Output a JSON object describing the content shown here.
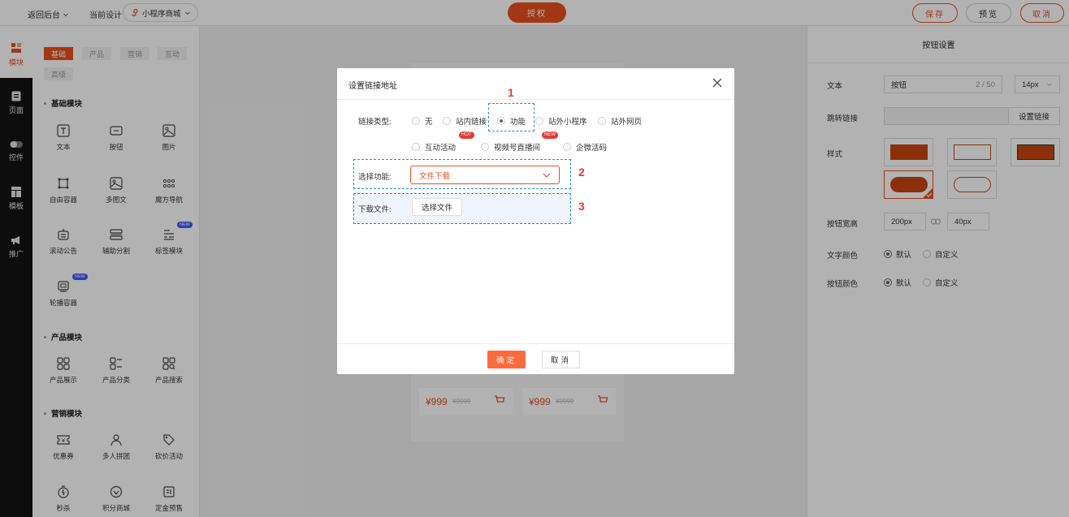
{
  "topbar": {
    "back_label": "返回后台",
    "current_design_label": "当前设计",
    "design_select_value": "小程序商城",
    "authorize_label": "授权",
    "save_label": "保存",
    "preview_label": "预览",
    "cancel_label": "取消",
    "accent_color": "#e8501c"
  },
  "rail": {
    "items": [
      {
        "label": "模块",
        "icon": "blocks-icon"
      },
      {
        "label": "页面",
        "icon": "page-icon"
      },
      {
        "label": "控件",
        "icon": "toggle-icon"
      },
      {
        "label": "模板",
        "icon": "template-icon"
      },
      {
        "label": "推广",
        "icon": "megaphone-icon"
      }
    ]
  },
  "panel": {
    "tabs": [
      "基础",
      "产品",
      "营销",
      "互动",
      "高级"
    ],
    "sections": [
      {
        "title": "基础模块",
        "items": [
          {
            "label": "文本"
          },
          {
            "label": "按钮"
          },
          {
            "label": "图片"
          },
          {
            "label": "自由容器"
          },
          {
            "label": "多图文"
          },
          {
            "label": "魔方导航"
          },
          {
            "label": "滚动公告"
          },
          {
            "label": "辅助分割"
          },
          {
            "label": "标签模块",
            "badge": "NEW"
          },
          {
            "label": "轮播容器",
            "badge": "NEW"
          }
        ]
      },
      {
        "title": "产品模块",
        "items": [
          {
            "label": "产品展示"
          },
          {
            "label": "产品分类"
          },
          {
            "label": "产品搜索"
          }
        ]
      },
      {
        "title": "营销模块",
        "items": [
          {
            "label": "优惠券"
          },
          {
            "label": "多人拼团"
          },
          {
            "label": "砍价活动"
          },
          {
            "label": "秒杀"
          },
          {
            "label": "积分商城"
          },
          {
            "label": "定金预售"
          }
        ]
      }
    ]
  },
  "canvas": {
    "product_price": "¥999",
    "product_orig_price": "¥9999"
  },
  "right_panel": {
    "title": "按钮设置",
    "text_label": "文本",
    "text_value": "按钮",
    "text_count": "2 / 50",
    "font_size": "14px",
    "link_label": "跳转链接",
    "link_button": "设置链接",
    "style_label": "样式",
    "width_height_label": "按钮宽高",
    "width_value": "200px",
    "height_value": "40px",
    "text_color_label": "文字颜色",
    "button_color_label": "按钮颜色",
    "option_default": "默认",
    "option_custom": "自定义"
  },
  "modal": {
    "title": "设置链接地址",
    "link_type_label": "链接类型:",
    "link_types": [
      "无",
      "站内链接",
      "功能",
      "站外小程序",
      "站外网页",
      "互动活动",
      "视频号直播间",
      "企微活码"
    ],
    "selected_type": "功能",
    "hot_badge": "HOT",
    "new_badge": "NEW",
    "function_label": "选择功能:",
    "function_value": "文件下载",
    "download_label": "下载文件:",
    "choose_file_label": "选择文件",
    "ok_label": "确定",
    "cancel_label": "取消",
    "annotations": [
      "1",
      "2",
      "3"
    ]
  }
}
